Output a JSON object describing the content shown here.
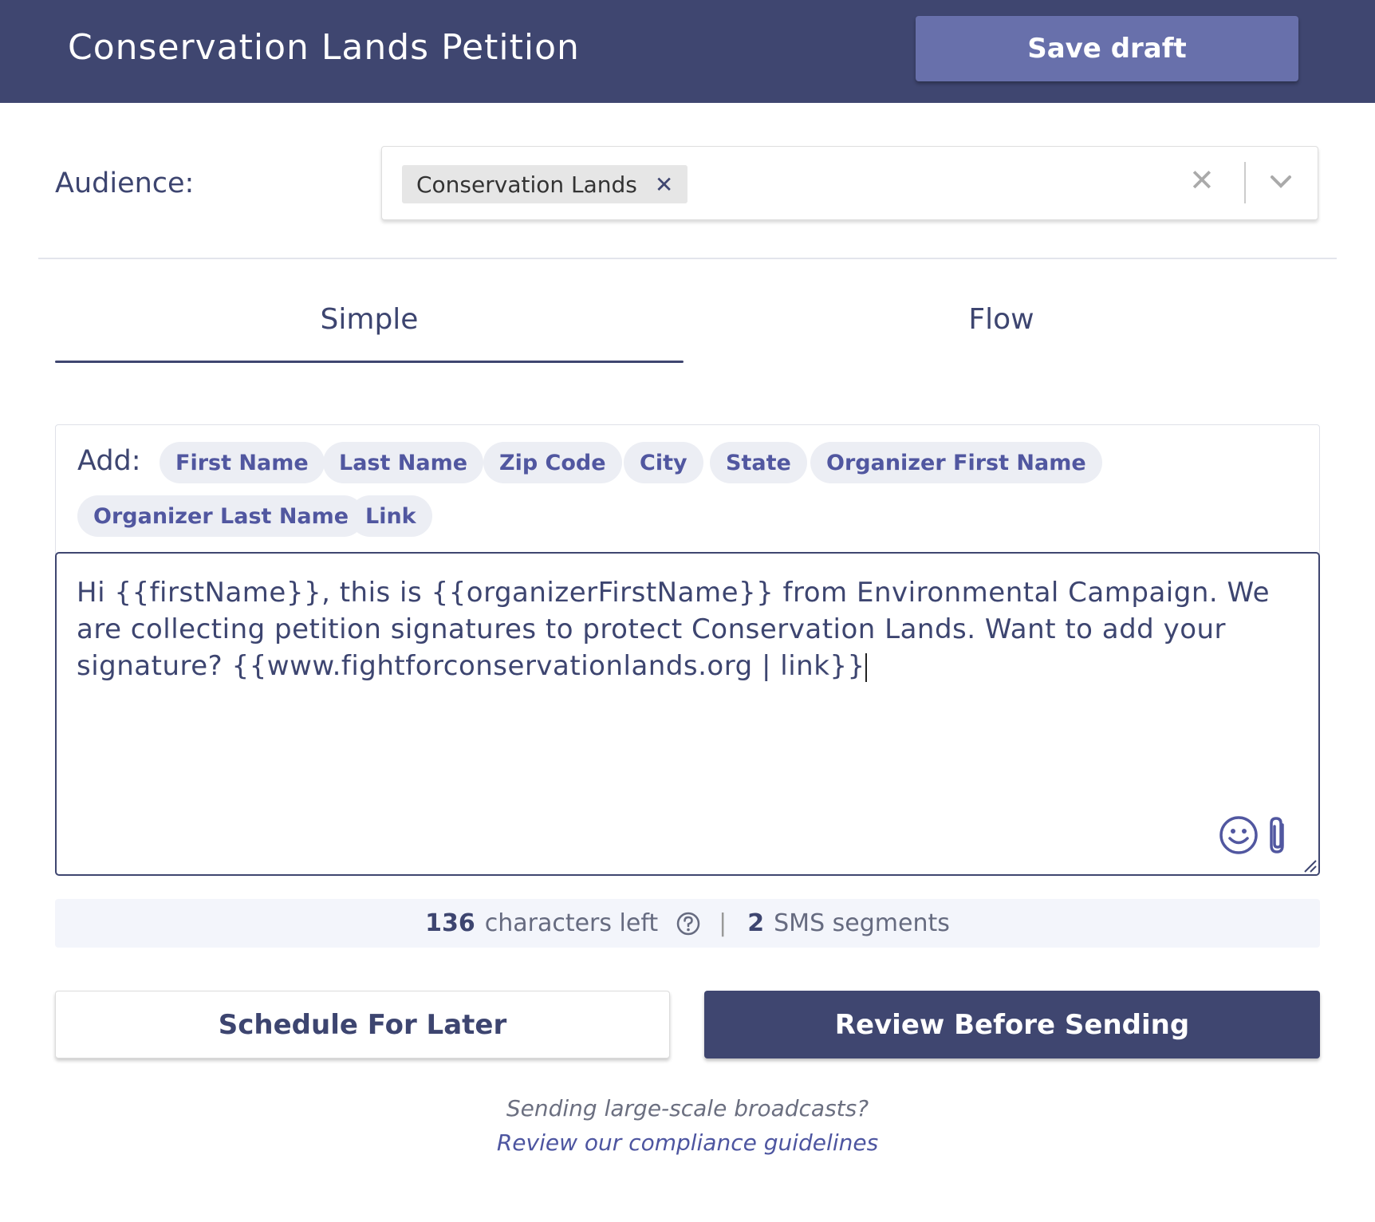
{
  "header": {
    "title": "Conservation Lands Petition",
    "save_label": "Save draft"
  },
  "audience": {
    "label": "Audience:",
    "selected": [
      "Conservation Lands"
    ],
    "chip_remove_glyph": "✕",
    "clear_glyph": "✕"
  },
  "tabs": [
    {
      "label": "Simple",
      "active": true
    },
    {
      "label": "Flow",
      "active": false
    }
  ],
  "composer": {
    "add_label": "Add:",
    "tokens": [
      "First Name",
      "Last Name",
      "Zip Code",
      "City",
      "State",
      "Organizer First Name",
      "Organizer Last Name",
      "Link"
    ],
    "message": "Hi {{firstName}}, this is {{organizerFirstName}} from Environmental Campaign. We are collecting petition signatures to protect Conservation Lands. Want to add your signature? {{www.fightforconservationlands.org | link}}",
    "icons": [
      "emoji-icon",
      "paperclip-icon",
      "resize-handle-icon"
    ]
  },
  "counter": {
    "chars_left": "136",
    "chars_left_label": "characters left",
    "separator": "|",
    "segments": "2",
    "segments_label": "SMS segments"
  },
  "actions": {
    "schedule_label": "Schedule For Later",
    "review_label": "Review Before Sending"
  },
  "footer": {
    "line1": "Sending large-scale broadcasts?",
    "link": "Review our compliance guidelines"
  },
  "colors": {
    "header_bg": "#3f4670",
    "save_button": "#6870ab",
    "token_text": "#5157a0",
    "primary_button": "#3f4670"
  }
}
